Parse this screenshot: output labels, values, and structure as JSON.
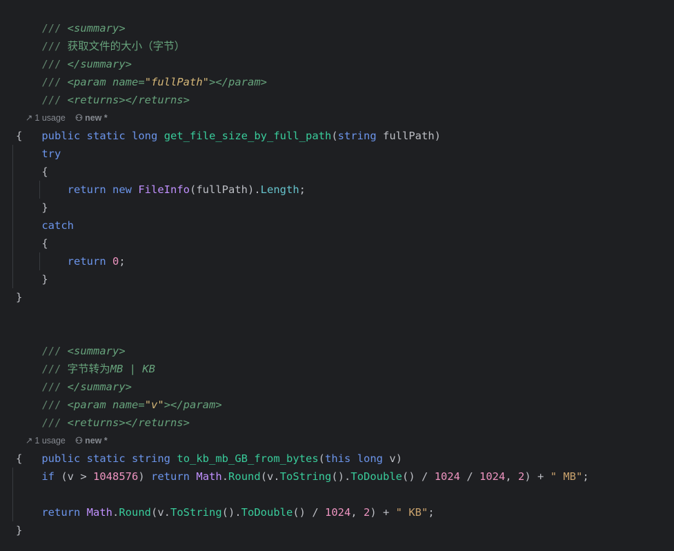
{
  "method1": {
    "doc": {
      "prefix": "///",
      "summary_open": "<summary>",
      "summary_text": "获取文件的大小（字节）",
      "summary_close": "</summary>",
      "param_open": "<param",
      "param_attr": "name=",
      "param_value": "\"fullPath\"",
      "param_close": "></param>",
      "returns": "<returns></returns>"
    },
    "hint": {
      "usage": "1 usage",
      "author": "new *"
    },
    "signature": {
      "mod1": "public",
      "mod2": "static",
      "ret": "long",
      "name": "get_file_size_by_full_path",
      "params_open": "(",
      "param_type": "string",
      "param_name": "fullPath",
      "params_close": ")"
    },
    "body": {
      "brace_open": "{",
      "try_kw": "try",
      "try_open": "{",
      "return_kw": "return",
      "new_kw": "new",
      "class_name": "FileInfo",
      "call_args": "(fullPath).",
      "prop": "Length",
      "semi": ";",
      "try_close": "}",
      "catch_kw": "catch",
      "catch_open": "{",
      "catch_return": "return",
      "zero": "0",
      "catch_semi": ";",
      "catch_close": "}",
      "brace_close": "}"
    }
  },
  "method2": {
    "doc": {
      "prefix": "///",
      "summary_open": "<summary>",
      "summary_text_cn": "字节转为",
      "summary_text_units": "MB | KB",
      "summary_close": "</summary>",
      "param_open": "<param",
      "param_attr": "name=",
      "param_value": "\"v\"",
      "param_close": "></param>",
      "returns": "<returns></returns>"
    },
    "hint": {
      "usage": "1 usage",
      "author": "new *"
    },
    "signature": {
      "mod1": "public",
      "mod2": "static",
      "ret": "string",
      "name": "to_kb_mb_GB_from_bytes",
      "params_open": "(",
      "this_kw": "this",
      "param_type": "long",
      "param_name": "v",
      "params_close": ")"
    },
    "body": {
      "brace_open": "{",
      "if_kw": "if",
      "cond_open": "(v > ",
      "threshold": "1048576",
      "cond_close": ") ",
      "return_kw": "return",
      "math": "Math",
      "dot1": ".",
      "round": "Round",
      "args1": "(v.",
      "tostring": "ToString",
      "paren_dot": "().",
      "todouble": "ToDouble",
      "div1": "() / ",
      "n1024a": "1024",
      "div2": " / ",
      "n1024b": "1024",
      "comma": ", ",
      "two": "2",
      "plus": ") + ",
      "mb_str": "\" MB\"",
      "semi": ";",
      "return2_kw": "return",
      "math2": "Math",
      "dot2": ".",
      "round2": "Round",
      "args2": "(v.",
      "tostring2": "ToString",
      "paren_dot2": "().",
      "todouble2": "ToDouble",
      "div3": "() / ",
      "n1024c": "1024",
      "comma2": ", ",
      "two2": "2",
      "plus2": ") + ",
      "kb_str": "\" KB\"",
      "semi2": ";",
      "brace_close": "}"
    }
  }
}
